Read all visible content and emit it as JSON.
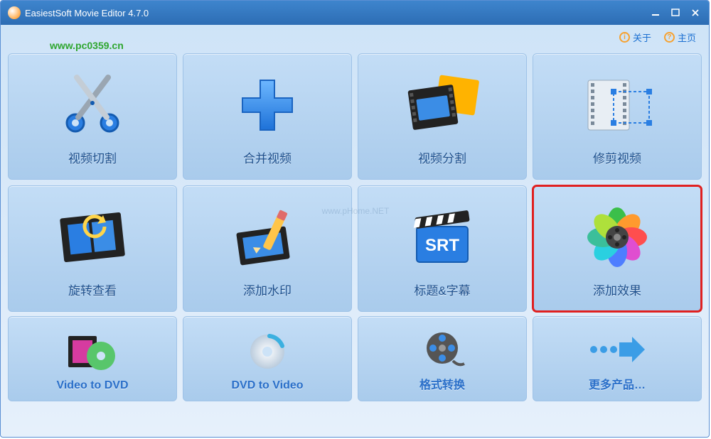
{
  "window": {
    "title": "EasiestSoft Movie Editor 4.7.0"
  },
  "url_watermark": "www.pc0359.cn",
  "center_watermark": "www.pHome.NET",
  "toplinks": {
    "about": "关于",
    "home": "主页"
  },
  "tiles": [
    {
      "id": "cut",
      "label": "视频切割"
    },
    {
      "id": "merge",
      "label": "合并视频"
    },
    {
      "id": "split",
      "label": "视频分割"
    },
    {
      "id": "trim",
      "label": "修剪视频"
    },
    {
      "id": "rotate",
      "label": "旋转查看"
    },
    {
      "id": "wmark",
      "label": "添加水印"
    },
    {
      "id": "srt",
      "label": "标题&字幕"
    },
    {
      "id": "effect",
      "label": "添加效果",
      "selected": true
    }
  ],
  "row3": [
    {
      "id": "v2dvd",
      "label": "Video to DVD"
    },
    {
      "id": "dvd2v",
      "label": "DVD to Video"
    },
    {
      "id": "conv",
      "label": "格式转换"
    },
    {
      "id": "more",
      "label": "更多产品…"
    }
  ]
}
